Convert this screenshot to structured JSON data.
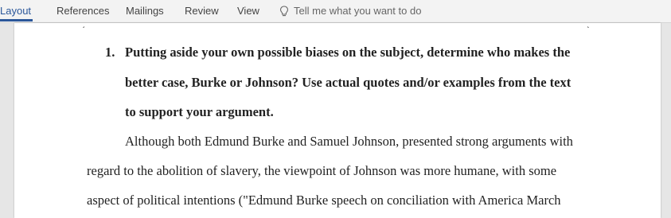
{
  "ribbon": {
    "tabs": [
      {
        "label": "Layout",
        "active": true
      },
      {
        "label": "References",
        "active": false
      },
      {
        "label": "Mailings",
        "active": false
      },
      {
        "label": "Review",
        "active": false
      },
      {
        "label": "View",
        "active": false
      }
    ],
    "tell_me_placeholder": "Tell me what you want to do",
    "accent_color": "#2b579a"
  },
  "document": {
    "list_number": "1.",
    "question_lines": [
      "Putting aside your own possible biases on the subject, determine who makes the",
      "better case, Burke or Johnson? Use actual quotes and/or examples from the text",
      "to support your argument."
    ],
    "paragraph_lines": [
      "Although both Edmund Burke and Samuel Johnson, presented strong arguments with",
      "regard to the abolition of slavery, the viewpoint of Johnson was more humane, with some",
      "aspect of political intentions (\"Edmund Burke speech on conciliation with America March"
    ]
  }
}
